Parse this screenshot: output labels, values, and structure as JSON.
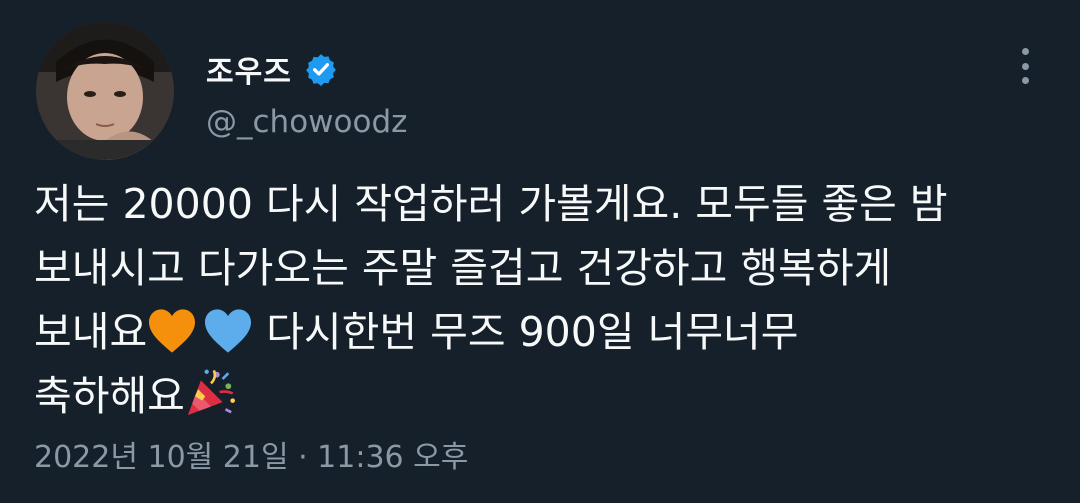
{
  "author": {
    "display_name": "조우즈",
    "handle": "@_chowoodz",
    "verified": true,
    "avatar_icon": "avatar-photo"
  },
  "tweet": {
    "line1": "저는 20000 다시 작업하러 가볼게요. 모두들 좋은 밤",
    "line2": "보내시고 다가오는 주말 즐겁고 건강하고 행복하게",
    "line3_prefix": "보내요",
    "line3_suffix": " 다시한번 무즈 900일 너무너무",
    "line4": "축하해요",
    "emojis": [
      "orange-heart-icon",
      "blue-heart-icon",
      "party-popper-icon"
    ]
  },
  "timestamp": "2022년 10월 21일 · 11:36 오후",
  "colors": {
    "background": "#15202b",
    "text": "#f7f9f9",
    "secondary": "#8b98a5",
    "verified_blue": "#1d9bf0",
    "orange_heart": "#f4900c",
    "blue_heart": "#5dadec"
  }
}
